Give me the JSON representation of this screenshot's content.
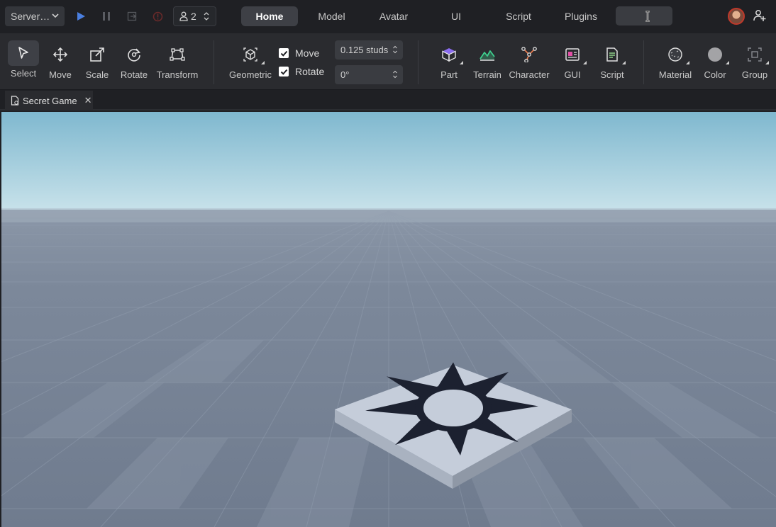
{
  "topbar": {
    "mode_select": "Server…",
    "player_count": "2",
    "tabs": [
      {
        "label": "Home",
        "active": true
      },
      {
        "label": "Model",
        "active": false
      },
      {
        "label": "Avatar",
        "active": false
      },
      {
        "label": "UI",
        "active": false
      },
      {
        "label": "Script",
        "active": false
      },
      {
        "label": "Plugins",
        "active": false
      }
    ]
  },
  "toolbar": {
    "tools": {
      "select": "Select",
      "move": "Move",
      "scale": "Scale",
      "rotate": "Rotate",
      "transform": "Transform",
      "geometric": "Geometric",
      "part": "Part",
      "terrain": "Terrain",
      "character": "Character",
      "gui": "GUI",
      "script": "Script",
      "material": "Material",
      "color": "Color",
      "group": "Group"
    },
    "snap": {
      "move_label": "Move",
      "move_checked": true,
      "rotate_label": "Rotate",
      "rotate_checked": true,
      "move_increment": "0.125 studs",
      "rotate_increment": "0°"
    }
  },
  "document": {
    "tab_title": "Secret Game"
  },
  "colors": {
    "accent_play": "#4a7fe0",
    "sky_top": "#7fb8cf",
    "sky_horizon": "#c8e2ea",
    "baseplate": "#7b8899",
    "spawn_top": "#c5cdda",
    "spawn_decal": "#1c2130"
  },
  "icons": [
    "play-icon",
    "pause-icon",
    "stop-icon",
    "person-icon",
    "search-cursor-icon",
    "add-friend-icon",
    "document-icon",
    "close-icon"
  ]
}
